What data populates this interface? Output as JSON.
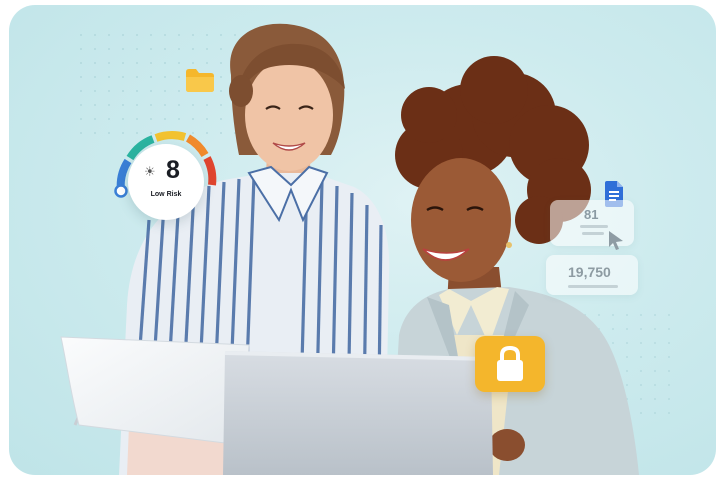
{
  "risk_gauge": {
    "score": "8",
    "label": "Low Risk",
    "sun_glyph": "☀",
    "arc_colors": [
      "#3a7fd6",
      "#2bb3a0",
      "#f2c230",
      "#f08a2c",
      "#e0452f"
    ]
  },
  "stats": [
    {
      "value": "81"
    },
    {
      "value": "19,750"
    }
  ],
  "icons": {
    "folder": "folder-icon",
    "document": "document-icon",
    "cursor": "cursor-icon",
    "lock": "lock-icon"
  },
  "colors": {
    "background": "#cdebee",
    "lock_badge": "#f4b62c",
    "folder": "#f5b72c",
    "document": "#2f6fd8"
  }
}
